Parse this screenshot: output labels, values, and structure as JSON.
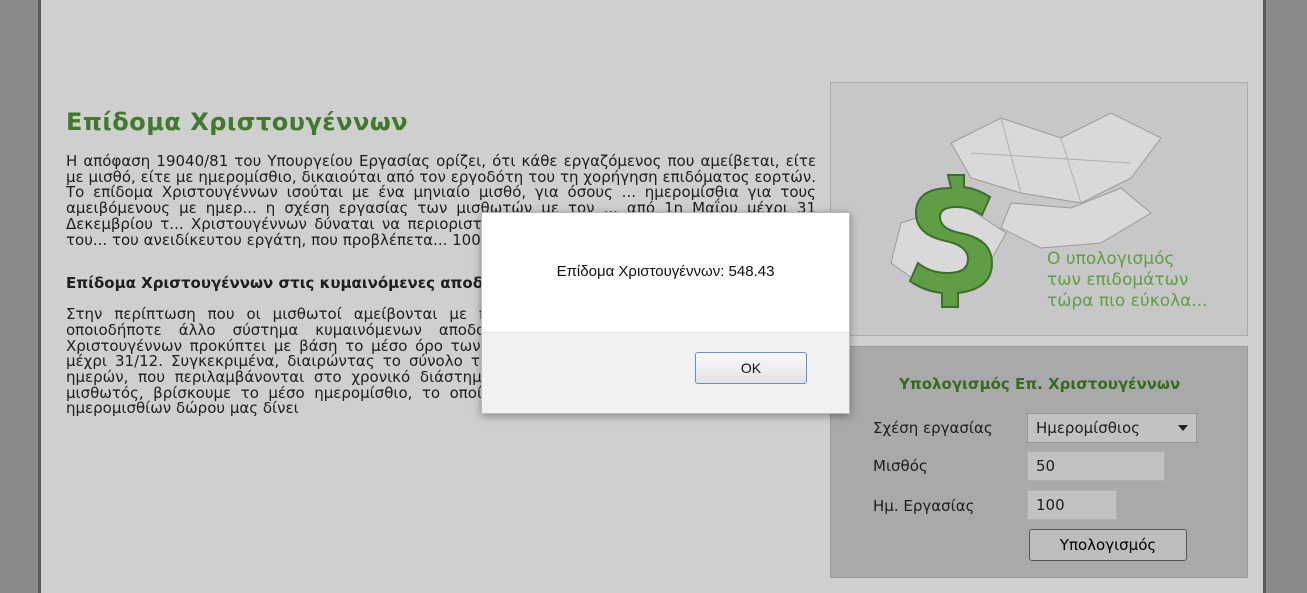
{
  "article": {
    "title": "Επίδομα Χριστουγέννων",
    "paragraph1": "Η απόφαση 19040/81 του Υπουργείου Εργασίας ορίζει, ότι κάθε εργαζόμενος που αμείβεται, είτε με μισθό, είτε με ημερομίσθιο, δικαιούται από τον εργοδότη του τη χορήγηση επιδόματος εορτών. Το επίδομα Χριστουγέννων ισούται με ένα μηνιαίο μισθό, για όσους ... ημερομίσθια για τους αμειβόμενους με ημερ... η σχέση εργασίας των μισθωτών με τον ... από 1η Μαΐου μέχρι 31 Δεκεμβρίου τ... Χριστουγέννων δύναται να περιοριστεί ω... προκύπτει από τον πολλαπλασιασμό του... του ανειδίκευτου εργάτη, που προβλέπετα... 100.",
    "heading2": "Επίδομα Χριστουγέννων στις κυμαινόμενες αποδοχές.",
    "paragraph2": "Στην περίπτωση που οι μισθωτοί αμείβονται με ποσοστά ή κατά μονάδα εργασίας ή με οποιοδήποτε άλλο σύστημα κυμαινόμενων αποδοχών, ο υπολογισμός του δώρου των Χριστουγέννων προκύπτει με βάση το μέσο όρο των αποδοχών που έλαβε ο μισθωτός από 1/5 μέχρι 31/12. Συγκεκριμένα, διαιρώντας το σύνολο των αποδοχών, με το συνολικό αριθμό των ημερών, που περιλαμβάνονται στο χρονικό διάστημα από 1/5 έως 31/12, όπου εργάστηκε ο μισθωτός, βρίσκουμε το μέσο ημερομίσθιο, το οποίο πολλαπλασιαζόμενο με τον αριθμό των ημερομισθίων δώρου μας δίνει"
  },
  "banner": {
    "line1": "Ο υπολογισμός",
    "line2": "των επιδομάτων",
    "line3": "τώρα πιο εύκολα..."
  },
  "calculator": {
    "title": "Υπολογισμός Επ. Χριστουγέννων",
    "relation_label": "Σχέση εργασίας",
    "relation_value": "Ημερομίσθιος",
    "salary_label": "Μισθός",
    "salary_value": "50",
    "days_label": "Ημ. Εργασίας",
    "days_value": "100",
    "calc_button": "Υπολογισμός"
  },
  "dialog": {
    "message": "Επίδομα Χριστουγέννων: 548.43",
    "ok_label": "OK"
  },
  "colors": {
    "title_green": "#3f7a2a",
    "banner_green": "#5f9e45",
    "widget_title": "#356b1f"
  },
  "icons": [
    "puzzle-dollar-image",
    "chevron-down-icon"
  ]
}
